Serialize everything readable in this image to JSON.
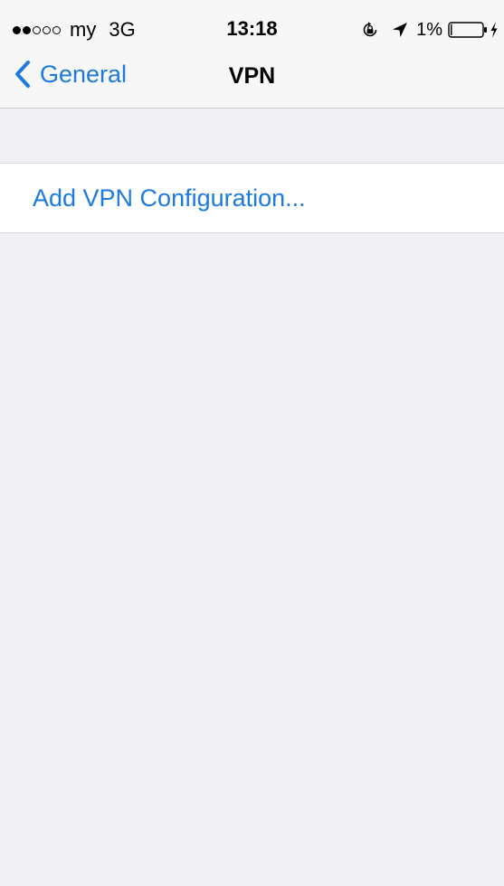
{
  "status_bar": {
    "carrier": "my",
    "network": "3G",
    "time": "13:18",
    "battery_percent": "1%",
    "signal_bars_filled": 2,
    "signal_bars_total": 5,
    "icons": [
      "rotation-lock-icon",
      "location-arrow-icon",
      "battery-icon",
      "charging-bolt-icon"
    ]
  },
  "nav": {
    "back_label": "General",
    "title": "VPN",
    "back_icon": "chevron-left-icon"
  },
  "list": {
    "add_vpn_label": "Add VPN Configuration..."
  },
  "colors": {
    "accent": "#1c7ae0",
    "background": "#efeff4",
    "bar": "#f7f7f7",
    "cell": "#ffffff",
    "separator": "#c8c7cc"
  }
}
